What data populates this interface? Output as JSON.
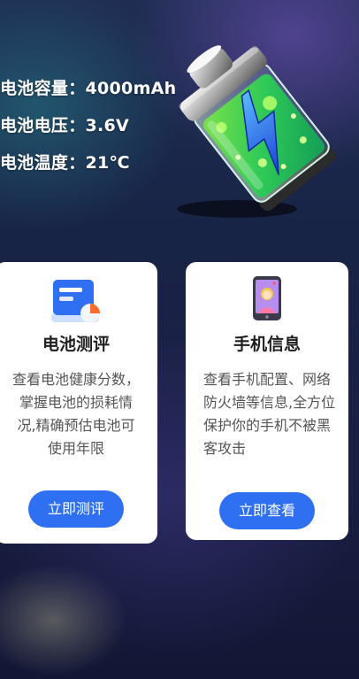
{
  "battery_info": {
    "capacity": "电池容量：4000mAh",
    "voltage": "电池电压：3.6V",
    "temperature": "电池温度：21℃"
  },
  "hero": {
    "icon": "battery-charging-icon"
  },
  "cards": {
    "battery_eval": {
      "icon": "battery-report-icon",
      "title": "电池测评",
      "description": "查看电池健康分数，掌握电池的损耗情况,精确预估电池可使用年限",
      "button_label": "立即测评"
    },
    "phone_info": {
      "icon": "phone-profile-icon",
      "title": "手机信息",
      "description": "查看手机配置、网络防火墙等信息,全方位保护你的手机不被黑客攻击",
      "button_label": "立即查看"
    }
  },
  "colors": {
    "accent": "#2f6ff2",
    "card_background": "#ffffff",
    "text_primary": "#1f1f1f",
    "text_secondary": "#555555"
  }
}
